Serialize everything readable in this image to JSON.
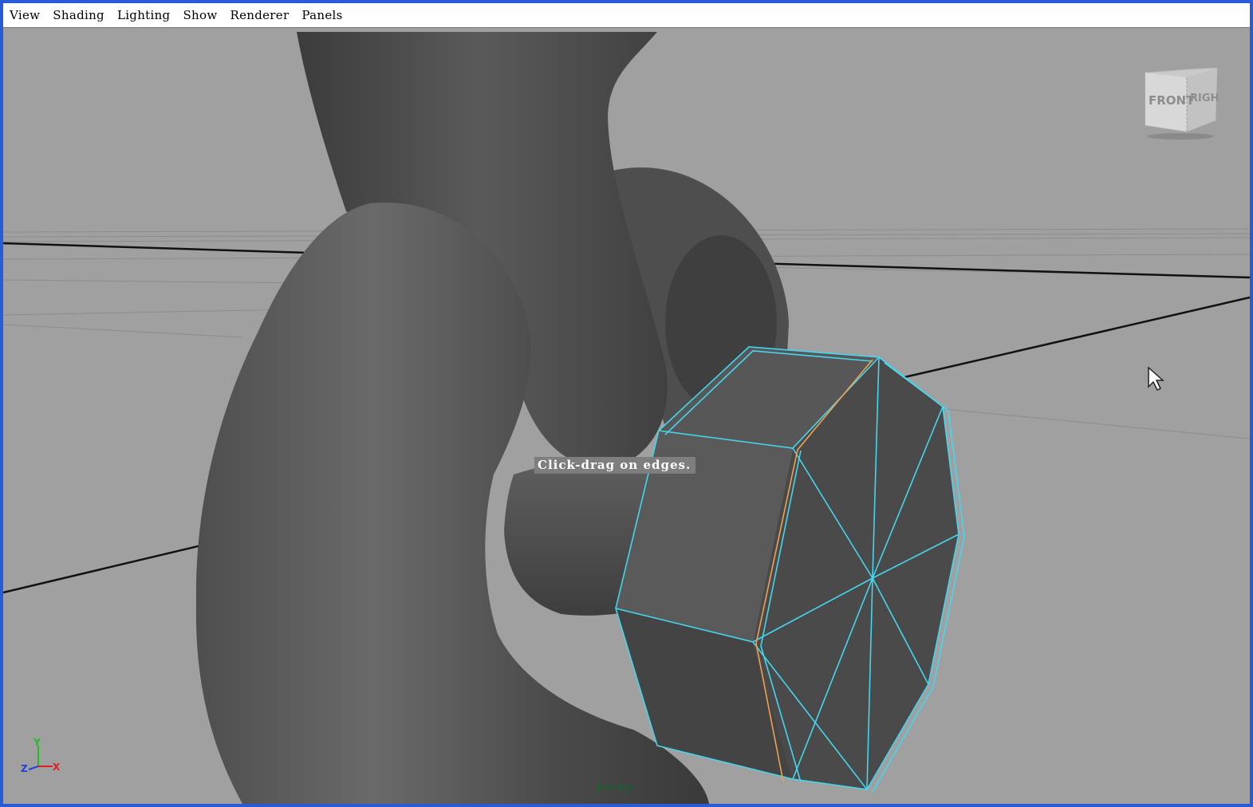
{
  "menu": {
    "items": [
      "View",
      "Shading",
      "Lighting",
      "Show",
      "Renderer",
      "Panels"
    ]
  },
  "viewport": {
    "hint": "Click-drag on edges.",
    "camera": "persp"
  },
  "viewcube": {
    "front": "FRONT",
    "right": "RIGHT"
  },
  "axes": {
    "x": "X",
    "y": "Y",
    "z": "Z"
  },
  "colors": {
    "selection_edge": "#44d6ee",
    "highlight_edge": "#f0a050",
    "background": "#a0a0a0",
    "mesh": "#555555"
  },
  "icons": [
    "pointer-cursor-icon",
    "viewcube-icon",
    "axis-gizmo-icon"
  ]
}
